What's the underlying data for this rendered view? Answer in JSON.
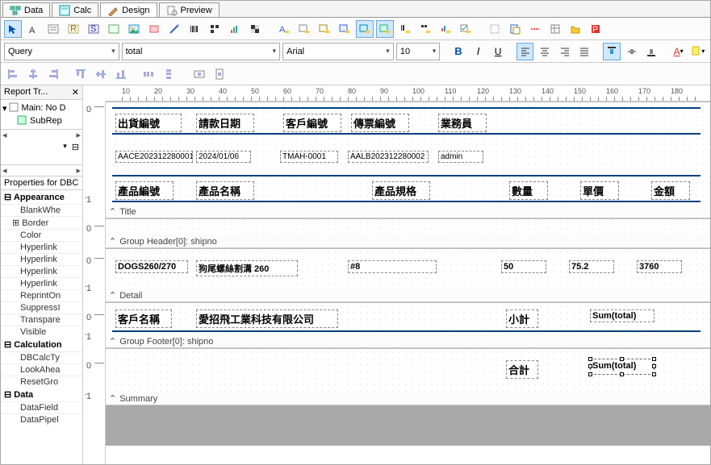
{
  "tabs": {
    "data": "Data",
    "calc": "Calc",
    "design": "Design",
    "preview": "Preview"
  },
  "dropdowns": {
    "query": "Query",
    "field": "total",
    "font": "Arial",
    "size": "10"
  },
  "tree": {
    "title": "Report Tr...",
    "main": "Main: No D",
    "sub": "SubRep"
  },
  "props": {
    "hdr": "Properties for DBC",
    "appearance": "Appearance",
    "blank": "BlankWhe",
    "border": "Border",
    "color": "Color",
    "hl1": "Hyperlink",
    "hl2": "Hyperlink",
    "hl3": "Hyperlink",
    "hl4": "Hyperlink",
    "reprint": "ReprintOn",
    "supp": "SuppressI",
    "transp": "Transpare",
    "visible": "Visible",
    "calc": "Calculation",
    "dbcalc": "DBCalcTy",
    "look": "LookAhea",
    "reset": "ResetGro",
    "data": "Data",
    "dfield": "DataField",
    "dpipe": "DataPipel"
  },
  "bands": {
    "title": "Title",
    "gh": "Group Header[0]: shipno",
    "detail": "Detail",
    "gf": "Group Footer[0]: shipno",
    "summary": "Summary"
  },
  "titleRow": {
    "c1": "出貨編號",
    "c2": "請款日期",
    "c3": "客戶編號",
    "c4": "傳票編號",
    "c5": "業務員"
  },
  "titleData": {
    "d1": "AACE202312280001",
    "d2": "2024/01/06",
    "d3": "TMAH-0001",
    "d4": "AALB202312280002",
    "d5": "admin"
  },
  "colHdr": {
    "h1": "產品編號",
    "h2": "產品名稱",
    "h3": "產品規格",
    "h4": "數量",
    "h5": "單價",
    "h6": "金額"
  },
  "detail": {
    "f1": "DOGS260/270",
    "f2": "狗尾螺絲割溝 260",
    "f3": "#8",
    "f4": "50",
    "f5": "75.2",
    "f6": "3760"
  },
  "gfoot": {
    "l1": "客戶名稱",
    "l2": "愛招飛工業科技有限公司",
    "l3": "小計",
    "l4": "Sum(total)"
  },
  "summary": {
    "l1": "合計",
    "l2": "Sum(total)"
  },
  "ruler": [
    "10",
    "20",
    "30",
    "40",
    "50",
    "60",
    "70",
    "80",
    "90",
    "100",
    "110",
    "120",
    "130",
    "140",
    "150",
    "160",
    "170",
    "180"
  ]
}
